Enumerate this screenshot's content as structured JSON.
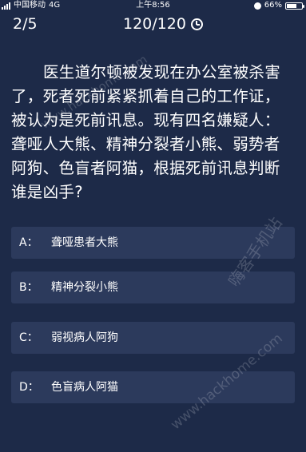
{
  "status_bar": {
    "carrier": "中国移动",
    "network": "4G",
    "time": "上午8:56",
    "battery": "66%",
    "battery_level": 0.66
  },
  "header": {
    "progress": "2/5",
    "timer": "120/120"
  },
  "question": {
    "text": "医生道尔顿被发现在办公室被杀害了，死者死前紧紧抓着自己的工作证，被认为是死前讯息。现有四名嫌疑人：聋哑人大熊、精神分裂者小熊、弱势者阿狗、色盲者阿猫，根据死前讯息判断谁是凶手?"
  },
  "options": [
    {
      "key": "A：",
      "text": "聋哑患者大熊"
    },
    {
      "key": "B：",
      "text": "精神分裂小熊"
    },
    {
      "key": "C：",
      "text": "弱视病人阿狗"
    },
    {
      "key": "D：",
      "text": "色盲病人阿猫"
    }
  ],
  "watermarks": [
    "www.hackhome.com",
    "嗨客手机站",
    "www.hackhome.com"
  ]
}
